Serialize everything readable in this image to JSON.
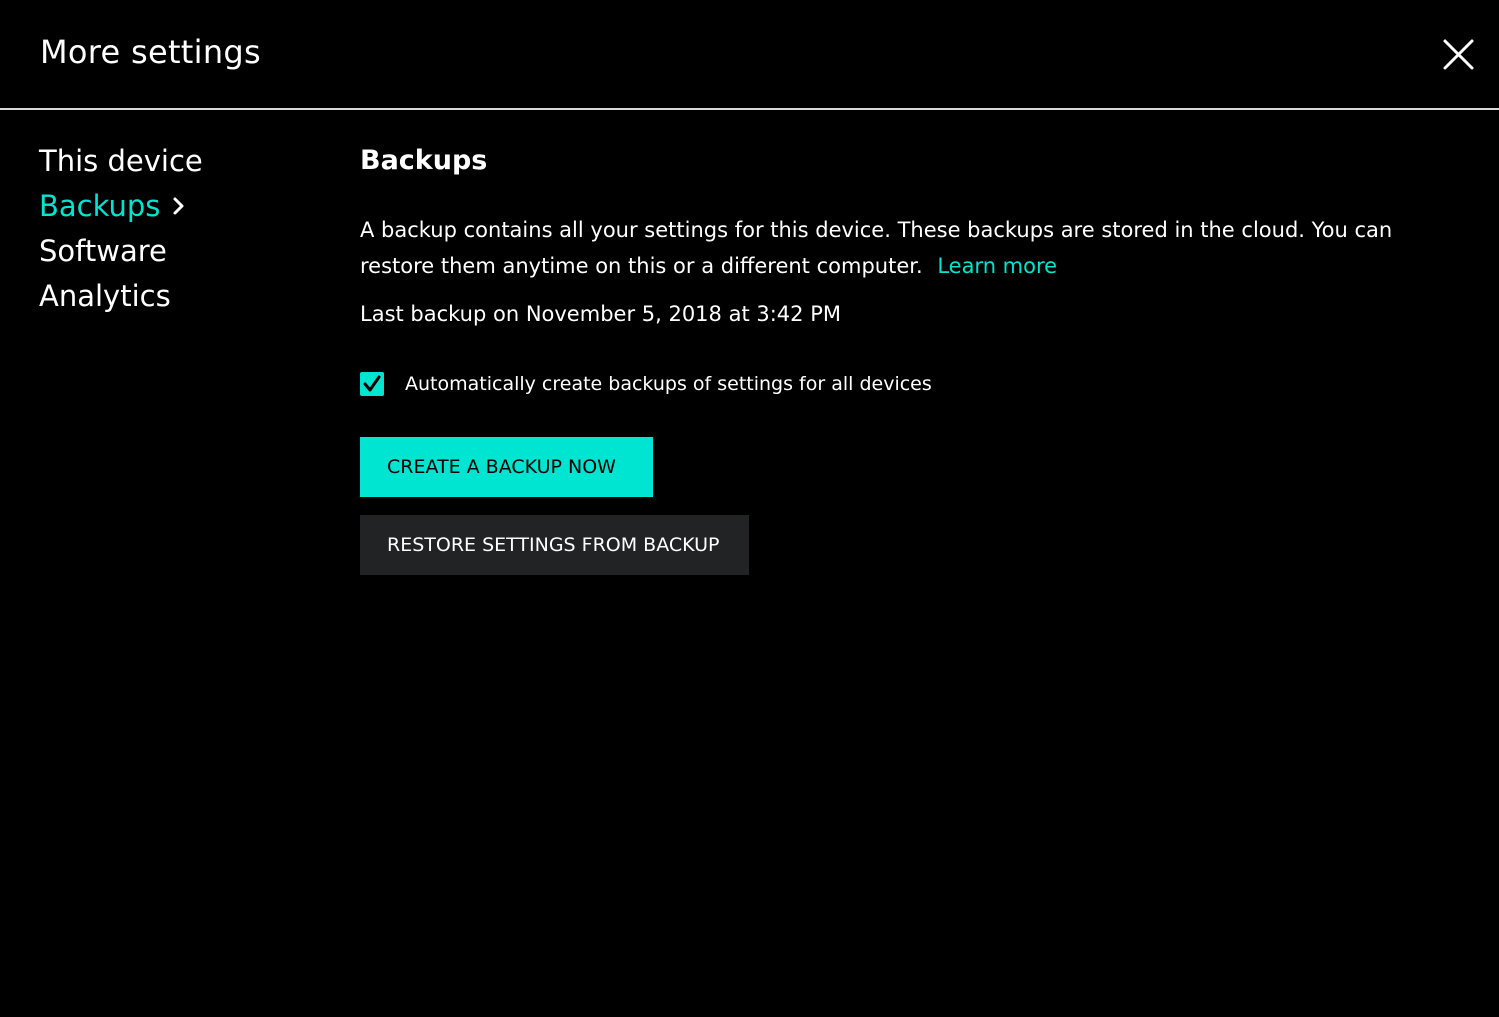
{
  "window": {
    "title": "More settings",
    "close_icon": "close-icon"
  },
  "sidebar": {
    "items": [
      {
        "label": "This device",
        "active": false
      },
      {
        "label": "Backups",
        "active": true
      },
      {
        "label": "Software",
        "active": false
      },
      {
        "label": "Analytics",
        "active": false
      }
    ],
    "active_icon": "chevron-right-icon"
  },
  "main": {
    "section_title": "Backups",
    "description": "A backup contains all your settings for this device. These backups are stored in the cloud. You can restore them anytime on this or a different computer.",
    "learn_more_label": "Learn more",
    "last_backup": "Last backup on November 5, 2018 at 3:42 PM",
    "auto_backup": {
      "label": "Automatically create backups of settings for all devices",
      "checked": true
    },
    "create_backup_label": "CREATE A BACKUP NOW",
    "restore_label": "RESTORE SETTINGS FROM BACKUP"
  },
  "colors": {
    "accent": "#00e5d1",
    "background": "#000000",
    "secondary_button": "#222325",
    "text": "#ffffff"
  }
}
